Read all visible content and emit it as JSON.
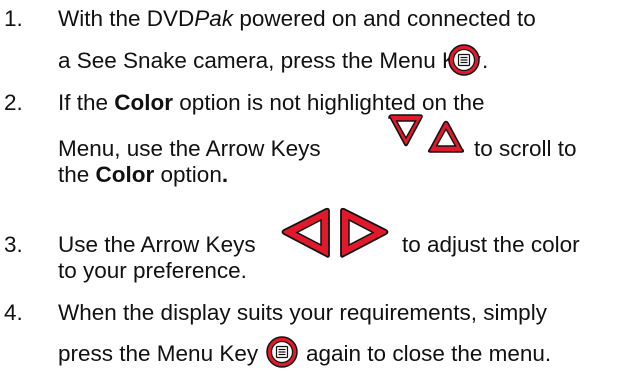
{
  "steps": [
    {
      "number": "1.",
      "line1": "With the DVD",
      "line1_italic": "Pak",
      "line1_rest": " powered on and connected to",
      "line2": "a See Snake camera, press the Menu Key",
      "line2_end": "."
    },
    {
      "number": "2.",
      "line1_a": "If the ",
      "line1_bold": "Color",
      "line1_b": " option is not highlighted on the",
      "line2_a": "Menu, use the Arrow Keys",
      "line2_b": "to scroll to",
      "line3_a": "the ",
      "line3_bold": "Color",
      "line3_b": " option",
      "line3_end": "."
    },
    {
      "number": "3.",
      "line1_a": "Use the Arrow Keys",
      "line1_b": "to adjust the color",
      "line2": "to your preference."
    },
    {
      "number": "4.",
      "line1": "When the display suits your requirements, simply",
      "line2_a": "press the Menu Key",
      "line2_b": "again to close the menu."
    }
  ],
  "icons": {
    "menu_key": "menu-key-icon",
    "arrow_down": "arrow-down-key-icon",
    "arrow_up": "arrow-up-key-icon",
    "arrow_left": "arrow-left-key-icon",
    "arrow_right": "arrow-right-key-icon"
  },
  "colors": {
    "key_red": "#e2192c",
    "text": "#111111"
  }
}
